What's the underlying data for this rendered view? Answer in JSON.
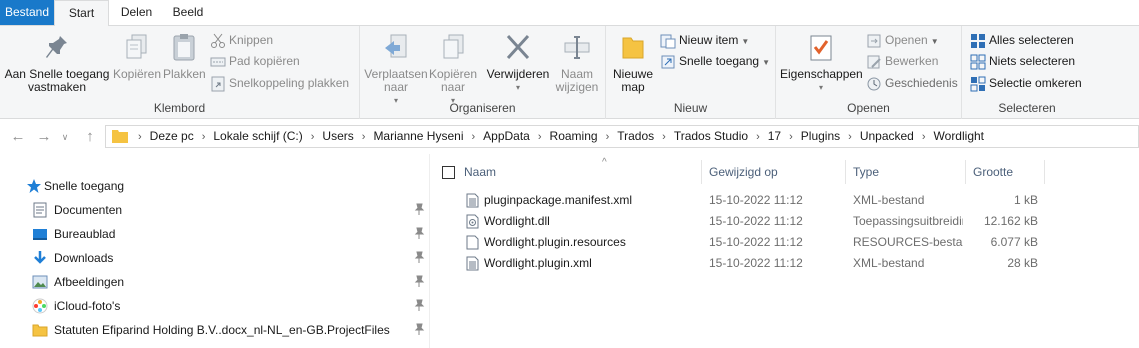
{
  "tabs": {
    "file": "Bestand",
    "start": "Start",
    "share": "Delen",
    "view": "Beeld"
  },
  "ribbon": {
    "klembord": {
      "label": "Klembord",
      "pin_quick": "Aan Snelle toegang",
      "pin_quick_2": "vastmaken",
      "copy": "Kopiëren",
      "paste": "Plakken",
      "cut": "Knippen",
      "copy_path": "Pad kopiëren",
      "paste_shortcut": "Snelkoppeling plakken"
    },
    "organiseren": {
      "label": "Organiseren",
      "move_to": "Verplaatsen",
      "move_to_2": "naar",
      "copy_to": "Kopiëren",
      "copy_to_2": "naar",
      "delete": "Verwijderen",
      "rename": "Naam",
      "rename_2": "wijzigen"
    },
    "nieuw": {
      "label": "Nieuw",
      "new_folder": "Nieuwe",
      "new_folder_2": "map",
      "new_item": "Nieuw item",
      "easy_access": "Snelle toegang"
    },
    "openen": {
      "label": "Openen",
      "properties": "Eigenschappen",
      "open": "Openen",
      "edit": "Bewerken",
      "history": "Geschiedenis"
    },
    "selecteren": {
      "label": "Selecteren",
      "select_all": "Alles selecteren",
      "select_none": "Niets selecteren",
      "invert": "Selectie omkeren"
    }
  },
  "address": {
    "crumbs": [
      "Deze pc",
      "Lokale schijf (C:)",
      "Users",
      "Marianne Hyseni",
      "AppData",
      "Roaming",
      "Trados",
      "Trados Studio",
      "17",
      "Plugins",
      "Unpacked",
      "Wordlight"
    ]
  },
  "nav": {
    "quick_access": "Snelle toegang",
    "items": [
      {
        "label": "Documenten",
        "icon": "documents-icon"
      },
      {
        "label": "Bureaublad",
        "icon": "desktop-icon"
      },
      {
        "label": "Downloads",
        "icon": "downloads-icon"
      },
      {
        "label": "Afbeeldingen",
        "icon": "pictures-icon"
      },
      {
        "label": "iCloud-foto's",
        "icon": "icloud-photos-icon"
      },
      {
        "label": "Statuten Efiparind Holding B.V..docx_nl-NL_en-GB.ProjectFiles",
        "icon": "folder-icon"
      }
    ]
  },
  "columns": {
    "name": "Naam",
    "modified": "Gewijzigd op",
    "type": "Type",
    "size": "Grootte"
  },
  "files": [
    {
      "name": "pluginpackage.manifest.xml",
      "modified": "15-10-2022 11:12",
      "type": "XML-bestand",
      "size": "1 kB",
      "icon": "xml-file-icon"
    },
    {
      "name": "Wordlight.dll",
      "modified": "15-10-2022 11:12",
      "type": "Toepassingsuitbreiding",
      "size": "12.162 kB",
      "icon": "dll-file-icon"
    },
    {
      "name": "Wordlight.plugin.resources",
      "modified": "15-10-2022 11:12",
      "type": "RESOURCES-bestand",
      "size": "6.077 kB",
      "icon": "file-icon"
    },
    {
      "name": "Wordlight.plugin.xml",
      "modified": "15-10-2022 11:12",
      "type": "XML-bestand",
      "size": "28 kB",
      "icon": "xml-file-icon"
    }
  ],
  "colors": {
    "file_tab": "#1979ca",
    "ribbon_bg": "#f5f6f7",
    "column_header": "#4c607a",
    "folder": "#f5c342"
  }
}
